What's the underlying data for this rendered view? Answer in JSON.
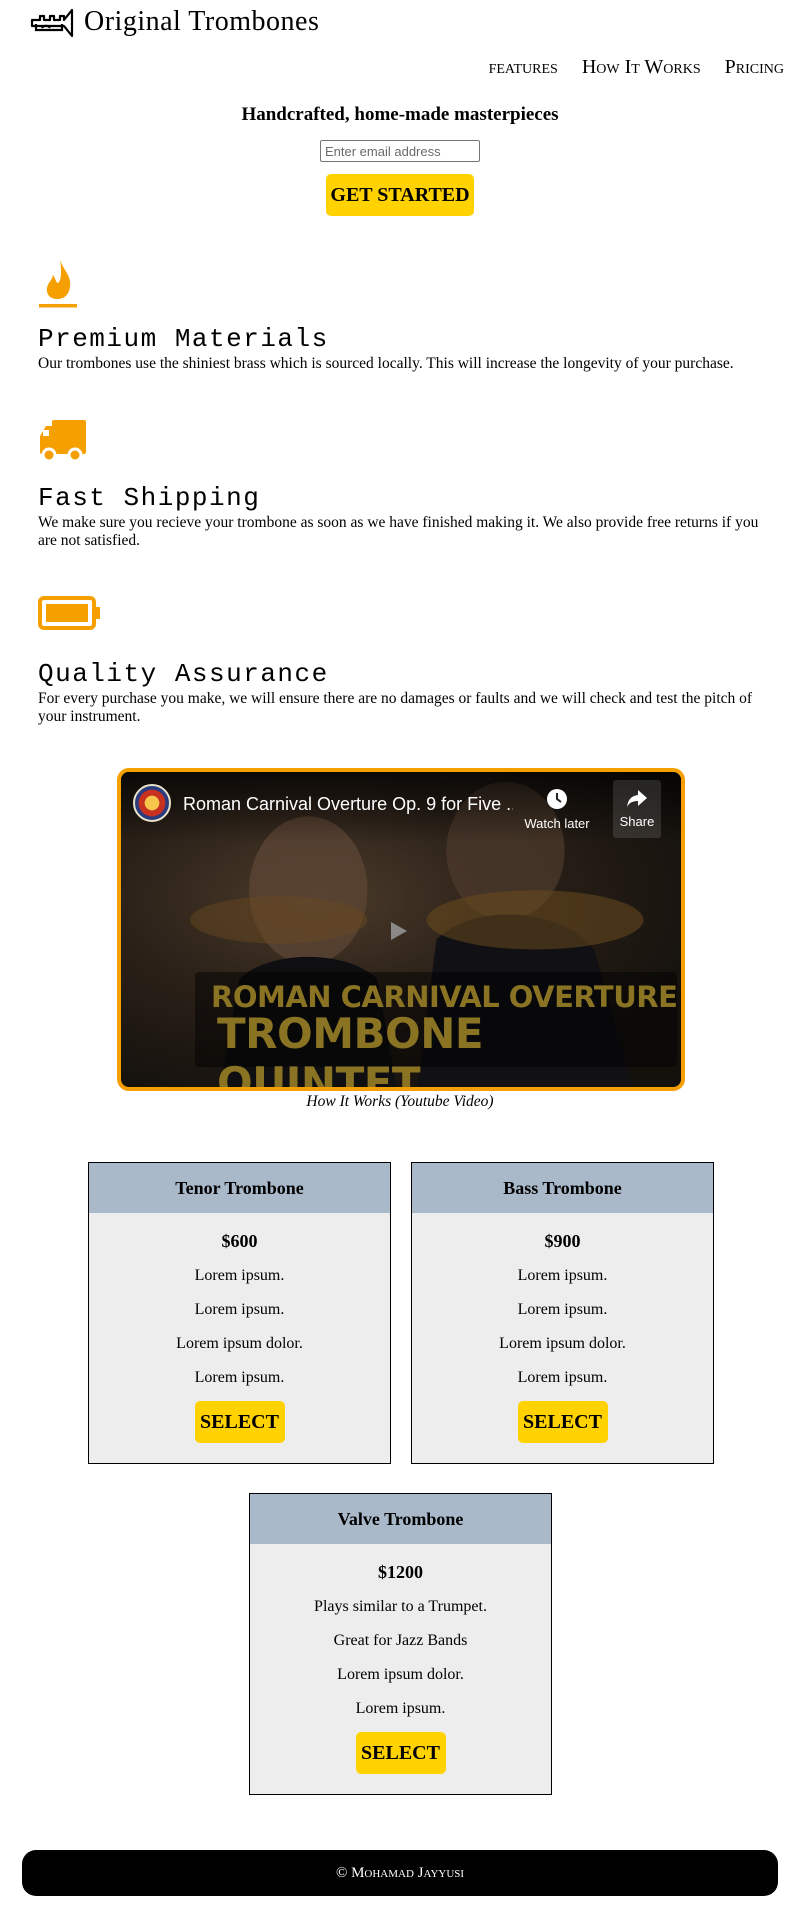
{
  "header": {
    "brand": "Original Trombones",
    "nav": [
      "features",
      "How It Works",
      "Pricing"
    ]
  },
  "hero": {
    "title": "Handcrafted, home-made masterpieces",
    "email_placeholder": "Enter email address",
    "cta": "GET STARTED"
  },
  "features": [
    {
      "icon": "flame-icon",
      "title": "Premium Materials",
      "text": "Our trombones use the shiniest brass which is sourced locally. This will increase the longevity of your purchase."
    },
    {
      "icon": "truck-icon",
      "title": "Fast Shipping",
      "text": "We make sure you recieve your trombone as soon as we have finished making it. We also provide free returns if you are not satisfied."
    },
    {
      "icon": "battery-icon",
      "title": "Quality Assurance",
      "text": "For every purchase you make, we will ensure there are no damages or faults and we will check and test the pitch of your instrument."
    }
  ],
  "video": {
    "title": "Roman Carnival Overture Op. 9 for Five ...",
    "watch_later": "Watch later",
    "share": "Share",
    "overlay_line1": "ROMAN CARNIVAL OVERTURE",
    "overlay_line2": "TROMBONE QUINTET",
    "caption": "How It Works (Youtube Video)"
  },
  "pricing": [
    {
      "name": "Tenor Trombone",
      "price": "$600",
      "lines": [
        "Lorem ipsum.",
        "Lorem ipsum.",
        "Lorem ipsum dolor.",
        "Lorem ipsum."
      ],
      "button": "SELECT"
    },
    {
      "name": "Bass Trombone",
      "price": "$900",
      "lines": [
        "Lorem ipsum.",
        "Lorem ipsum.",
        "Lorem ipsum dolor.",
        "Lorem ipsum."
      ],
      "button": "SELECT"
    },
    {
      "name": "Valve Trombone",
      "price": "$1200",
      "lines": [
        "Plays similar to a Trumpet.",
        "Great for Jazz Bands",
        "Lorem ipsum dolor.",
        "Lorem ipsum."
      ],
      "button": "SELECT"
    }
  ],
  "footer": {
    "text": "© Mohamad Jayyusi"
  },
  "colors": {
    "accent": "#ffd200",
    "icon": "#f5a000",
    "card_head": "#a9b9c9",
    "card_body": "#ededed"
  }
}
